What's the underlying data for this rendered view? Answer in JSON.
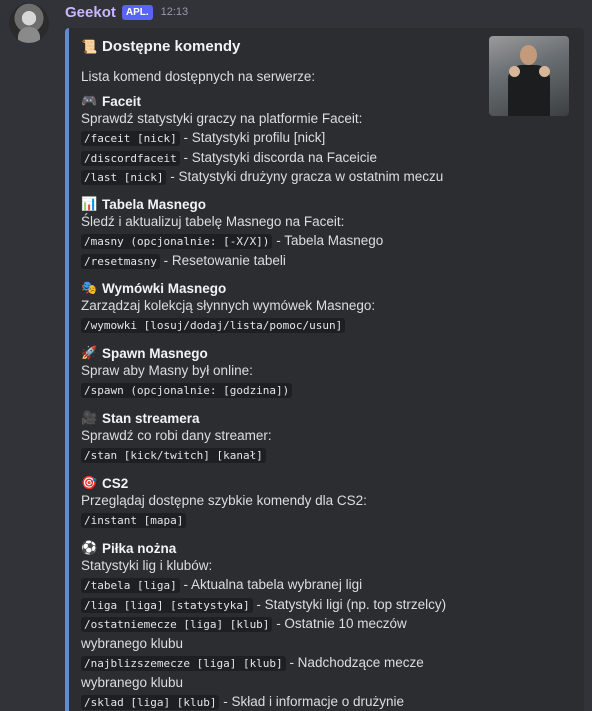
{
  "message": {
    "username": "Geekot",
    "app_badge": "APL.",
    "timestamp": "12:13"
  },
  "embed": {
    "accent_color": "#5b8cd6",
    "title": "Dostępne komendy",
    "title_icon": "scroll-icon",
    "description": "Lista komend dostępnych na serwerze:",
    "fields": [
      {
        "name": "Faceit",
        "icon": "gamepad-icon",
        "desc": "Sprawdź statystyki graczy na platformie Faceit:",
        "commands": [
          {
            "cmd": "/faceit [nick]",
            "text": " - Statystyki profilu [nick]"
          },
          {
            "cmd": "/discordfaceit",
            "text": " - Statystyki discorda na Faceicie"
          },
          {
            "cmd": "/last [nick]",
            "text": " - Statystyki drużyny gracza w ostatnim meczu"
          }
        ]
      },
      {
        "name": "Tabela Masnego",
        "icon": "bar-chart-icon",
        "desc": "Śledź i aktualizuj tabelę Masnego na Faceit:",
        "commands": [
          {
            "cmd": "/masny (opcjonalnie: [-X/X])",
            "text": " - Tabela Masnego"
          },
          {
            "cmd": "/resetmasny",
            "text": " - Resetowanie tabeli"
          }
        ]
      },
      {
        "name": "Wymówki Masnego",
        "icon": "masks-icon",
        "desc": "Zarządzaj kolekcją słynnych wymówek Masnego:",
        "commands": [
          {
            "cmd": "/wymowki [losuj/dodaj/lista/pomoc/usun]",
            "text": ""
          }
        ]
      },
      {
        "name": "Spawn Masnego",
        "icon": "rocket-icon",
        "desc": "Spraw aby Masny był online:",
        "commands": [
          {
            "cmd": "/spawn (opcjonalnie: [godzina])",
            "text": ""
          }
        ]
      },
      {
        "name": "Stan streamera",
        "icon": "camera-icon",
        "desc": "Sprawdź co robi dany streamer:",
        "commands": [
          {
            "cmd": "/stan [kick/twitch] [kanał]",
            "text": ""
          }
        ]
      },
      {
        "name": "CS2",
        "icon": "target-icon",
        "desc": "Przeglądaj dostępne szybkie komendy dla CS2:",
        "commands": [
          {
            "cmd": "/instant [mapa]",
            "text": ""
          }
        ]
      },
      {
        "name": "Piłka nożna",
        "icon": "soccer-ball-icon",
        "desc": "Statystyki lig i klubów:",
        "commands": [
          {
            "cmd": "/tabela [liga]",
            "text": " - Aktualna tabela wybranej ligi"
          },
          {
            "cmd": "/liga [liga] [statystyka]",
            "text": " - Statystyki ligi (np. top strzelcy)"
          },
          {
            "cmd": "/ostatniemecze [liga] [klub]",
            "text": " - Ostatnie 10 meczów wybranego klubu"
          },
          {
            "cmd": "/najblizszemecze [liga] [klub]",
            "text": " - Nadchodzące mecze wybranego klubu"
          },
          {
            "cmd": "/sklad [liga] [klub]",
            "text": " - Skład i informacje o drużynie"
          }
        ]
      }
    ]
  }
}
